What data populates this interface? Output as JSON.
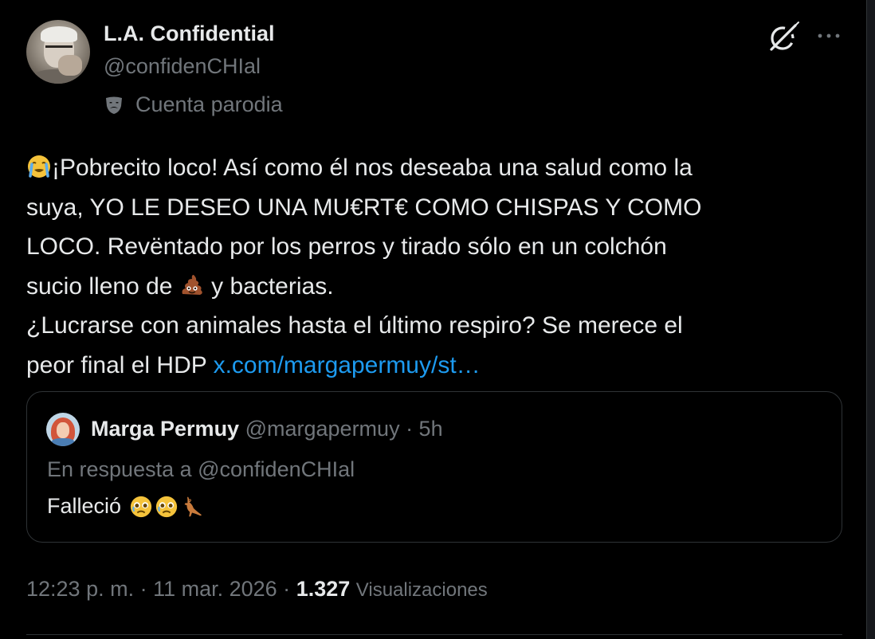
{
  "author": {
    "display_name": "L.A. Confidential",
    "handle": "@confidenCHIal",
    "label_icon": "parody-mask-icon",
    "label": "Cuenta parodia"
  },
  "header_actions": {
    "grok_icon": "grok-icon",
    "more_icon": "more-options-icon"
  },
  "tweet": {
    "lines": [
      {
        "emoji_before": "loudly-crying-face",
        "text": "¡Pobrecito loco! Así como él nos deseaba una salud como la"
      },
      {
        "text": "suya, YO LE DESEO UNA MU€RT€ COMO CHISPAS Y COMO"
      },
      {
        "text": "LOCO. Revëntado por los perros y tirado sólo en un colchón"
      },
      {
        "text_before": "sucio lleno de ",
        "emoji": "pile-of-poo",
        "text_after": " y bacterias."
      },
      {
        "text": "¿Lucrarse con animales hasta el último respiro? Se merece el"
      },
      {
        "text_before": "peor final el HDP ",
        "link": "x.com/margapermuy/st…"
      }
    ]
  },
  "quoted_post": {
    "name": "Marga Permuy",
    "handle_time": "@margapermuy · 5h",
    "reply_to": "En respuesta a @confidenCHIal",
    "text": "Falleció",
    "emojis": [
      "crying-face",
      "crying-face",
      "kangaroo"
    ]
  },
  "footer": {
    "time_date": "12:23 p. m. · 11 mar. 2026 · ",
    "views_count": "1.327",
    "views_label": "Visualizaciones"
  },
  "colors": {
    "background": "#000000",
    "primary_text": "#e7e9ea",
    "secondary_text": "#71767b",
    "link": "#1d9bf0",
    "border": "#2f3336"
  }
}
